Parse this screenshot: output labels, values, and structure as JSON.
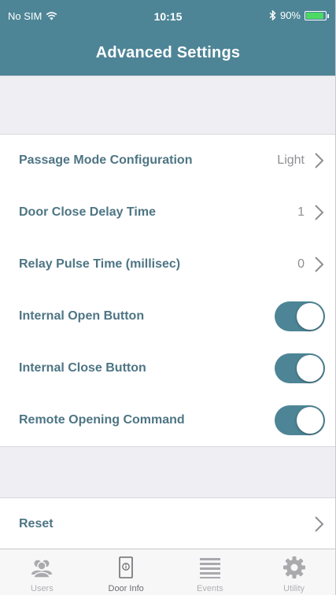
{
  "status_bar": {
    "carrier": "No SIM",
    "time": "10:15",
    "battery": "90%",
    "battery_level": 0.9
  },
  "header": {
    "title": "Advanced Settings"
  },
  "settings": {
    "passage_mode": {
      "label": "Passage Mode Configuration",
      "value": "Light"
    },
    "door_close_delay": {
      "label": "Door Close Delay Time",
      "value": "1"
    },
    "relay_pulse": {
      "label": "Relay Pulse Time (millisec)",
      "value": "0"
    },
    "internal_open": {
      "label": "Internal Open Button",
      "on": true
    },
    "internal_close": {
      "label": "Internal Close Button",
      "on": true
    },
    "remote_opening": {
      "label": "Remote Opening Command",
      "on": true
    }
  },
  "reset": {
    "label": "Reset"
  },
  "tabs": [
    {
      "label": "Users",
      "icon": "users-icon"
    },
    {
      "label": "Door Info",
      "icon": "door-info-icon"
    },
    {
      "label": "Events",
      "icon": "events-icon"
    },
    {
      "label": "Utility",
      "icon": "gear-icon"
    }
  ],
  "colors": {
    "accent": "#4d8596",
    "label_text": "#4e7584",
    "background": "#efeff3"
  }
}
